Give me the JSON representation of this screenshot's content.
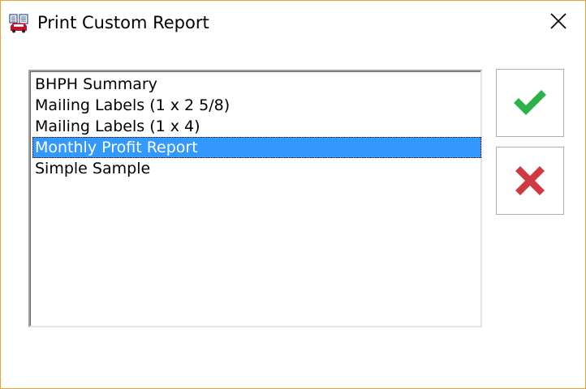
{
  "window": {
    "title": "Print Custom Report",
    "app_icon": "report-printer-icon",
    "close_icon": "close-icon",
    "border_color": "#e7a23c"
  },
  "report_list": {
    "items": [
      {
        "label": "BHPH Summary",
        "selected": false
      },
      {
        "label": "Mailing Labels (1 x 2 5/8)",
        "selected": false
      },
      {
        "label": "Mailing Labels (1 x 4)",
        "selected": false
      },
      {
        "label": "Monthly Profit Report",
        "selected": true
      },
      {
        "label": "Simple Sample",
        "selected": false
      }
    ],
    "selection_color": "#3399ff"
  },
  "buttons": {
    "ok": {
      "icon": "checkmark-icon",
      "color": "#2fb14a"
    },
    "cancel": {
      "icon": "x-icon",
      "color": "#d0393f"
    }
  }
}
